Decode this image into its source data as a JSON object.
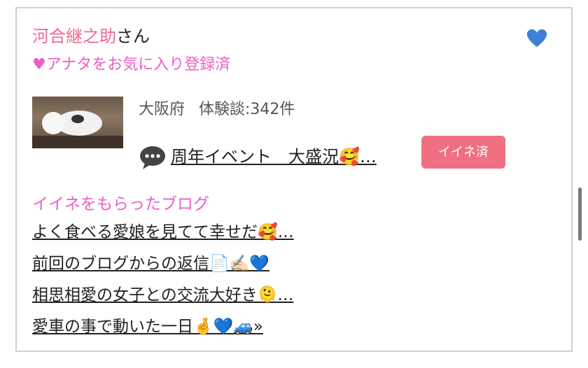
{
  "profile": {
    "name": "河合継之助",
    "honorific": "さん",
    "favorite_status": "♥アナタをお気に入り登録済",
    "location": "大阪府",
    "reviews": "体験談:342件"
  },
  "latest_post": {
    "title": "周年イベント　大盛況🥰…",
    "iine_button": "イイネ済"
  },
  "liked_blogs": {
    "heading": "イイネをもらったブログ",
    "items": [
      "よく食べる愛娘を見てて幸せだ🥰…",
      "前回のブログからの返信📄✍🏻💙",
      "相思相愛の女子との交流大好き🫠…",
      "愛車の事で動いた一日🤞💙🚙»"
    ]
  },
  "colors": {
    "name_pink": "#ee6a8f",
    "accent_pink": "#ea5fc8",
    "button_red": "#f07082",
    "heart_blue": "#3d82d6"
  },
  "icons": {
    "favorite": "blue-heart-icon",
    "post": "speech-bubble-icon"
  }
}
